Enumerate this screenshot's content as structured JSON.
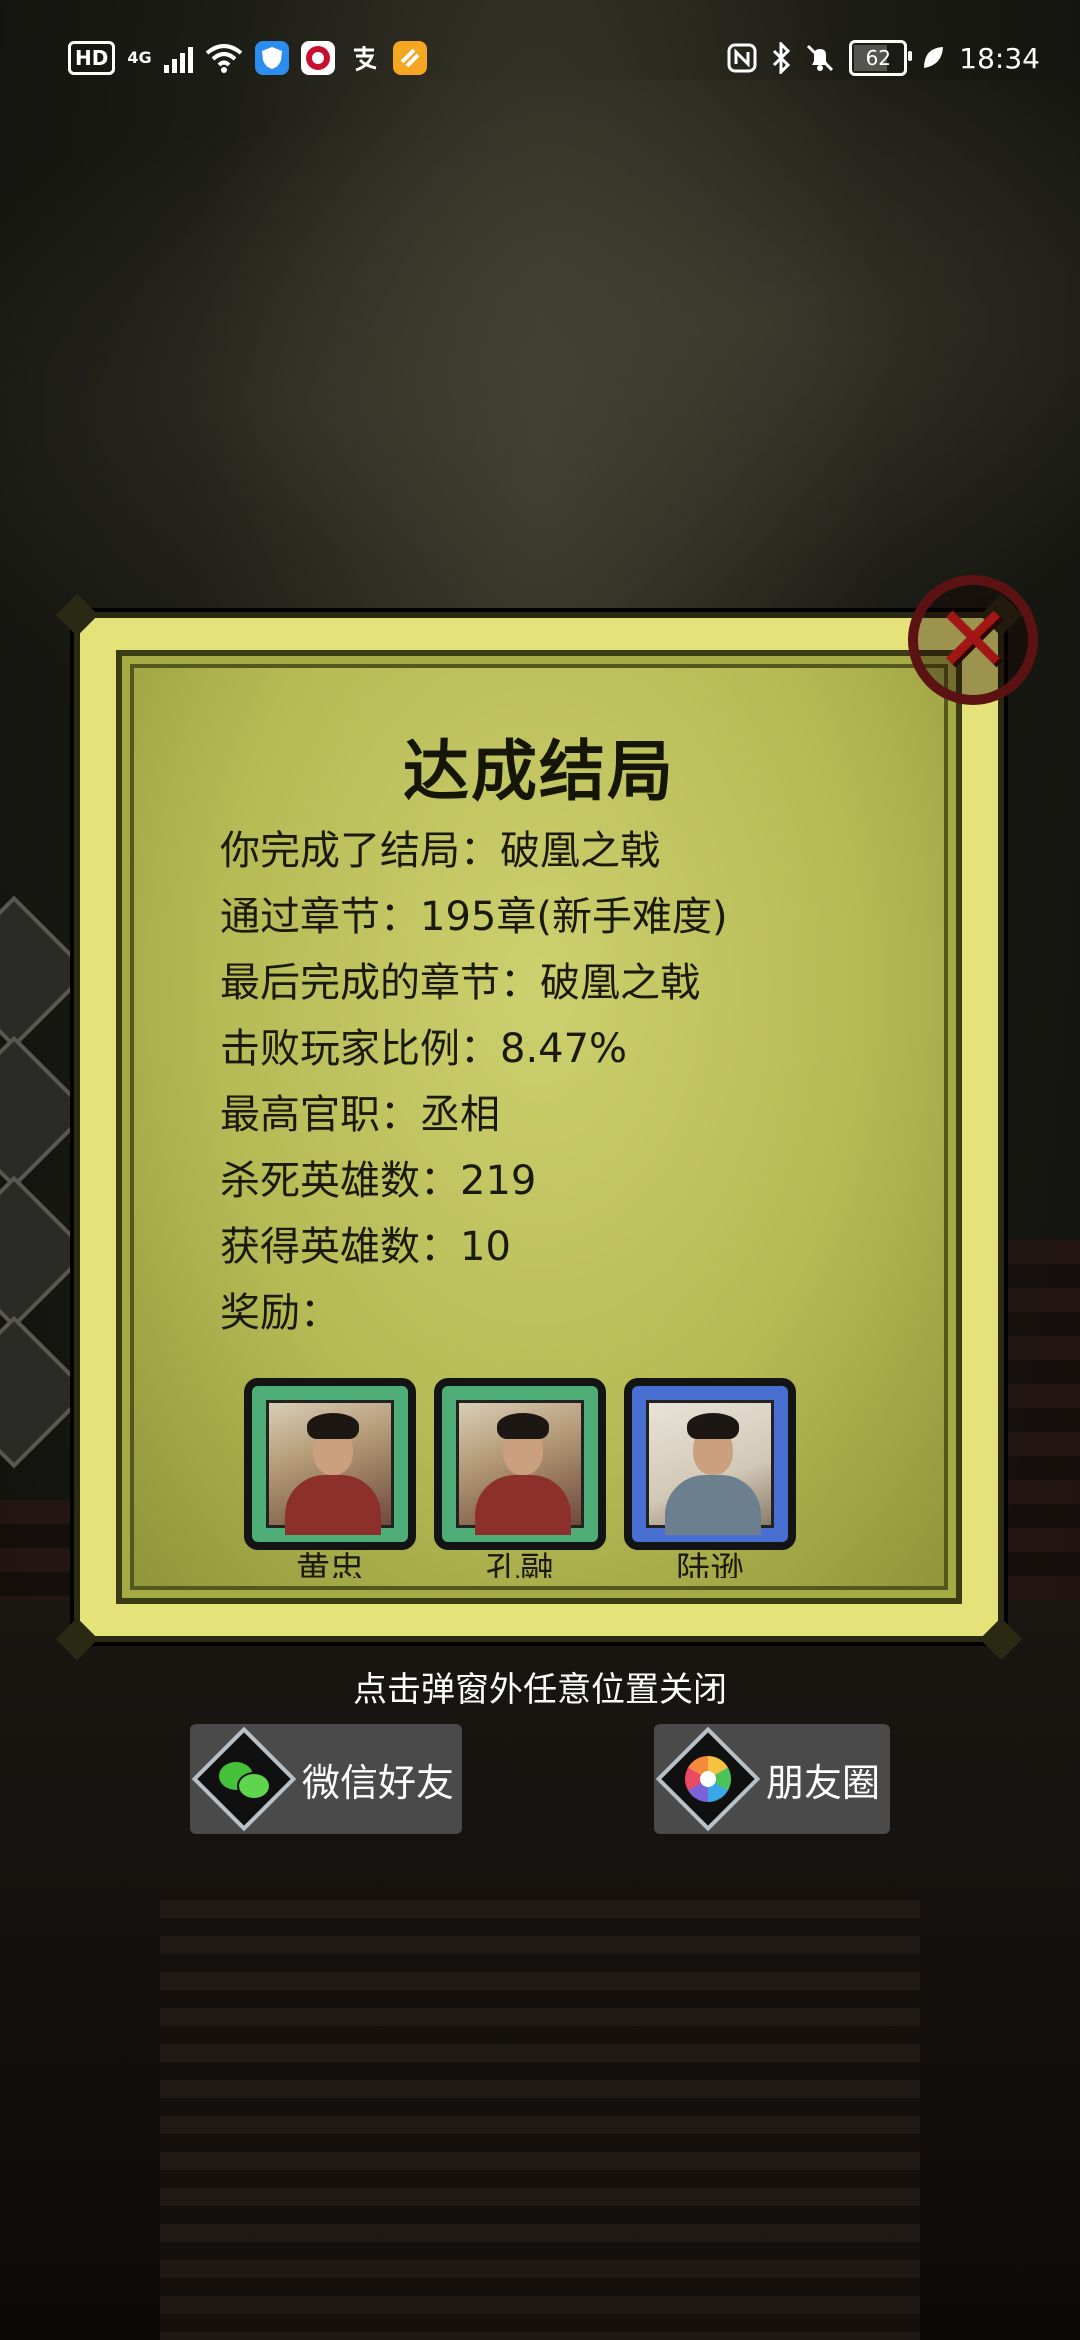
{
  "status_bar": {
    "left": {
      "hd": "HD",
      "network": "4G",
      "app_icons": [
        "shield-app-icon",
        "bank-app-icon",
        "alipay-icon",
        "mail-app-icon"
      ]
    },
    "right": {
      "battery": "62",
      "battery_level": 0.62,
      "time": "18:34"
    }
  },
  "dialog": {
    "title": "达成结局",
    "lines": [
      "你完成了结局：破凰之戟",
      "通过章节：195章(新手难度)",
      "最后完成的章节：破凰之戟",
      "击败玩家比例：8.47%",
      "最高官职：丞相",
      "杀死英雄数：219",
      "获得英雄数：10",
      "奖励："
    ],
    "rewards": [
      {
        "name": "黄忠",
        "frame": "green"
      },
      {
        "name": "孔融",
        "frame": "green"
      },
      {
        "name": "陆逊",
        "frame": "blue"
      }
    ]
  },
  "hint": "点击弹窗外任意位置关闭",
  "share": {
    "wechat_label": "微信好友",
    "moments_label": "朋友圈"
  },
  "colors": {
    "dialog_frame": "#e5e27a",
    "dialog_paper": "#b6ba55",
    "close_red": "#a31616",
    "reward_green": "#4fae78",
    "reward_blue": "#4a6fd3"
  }
}
